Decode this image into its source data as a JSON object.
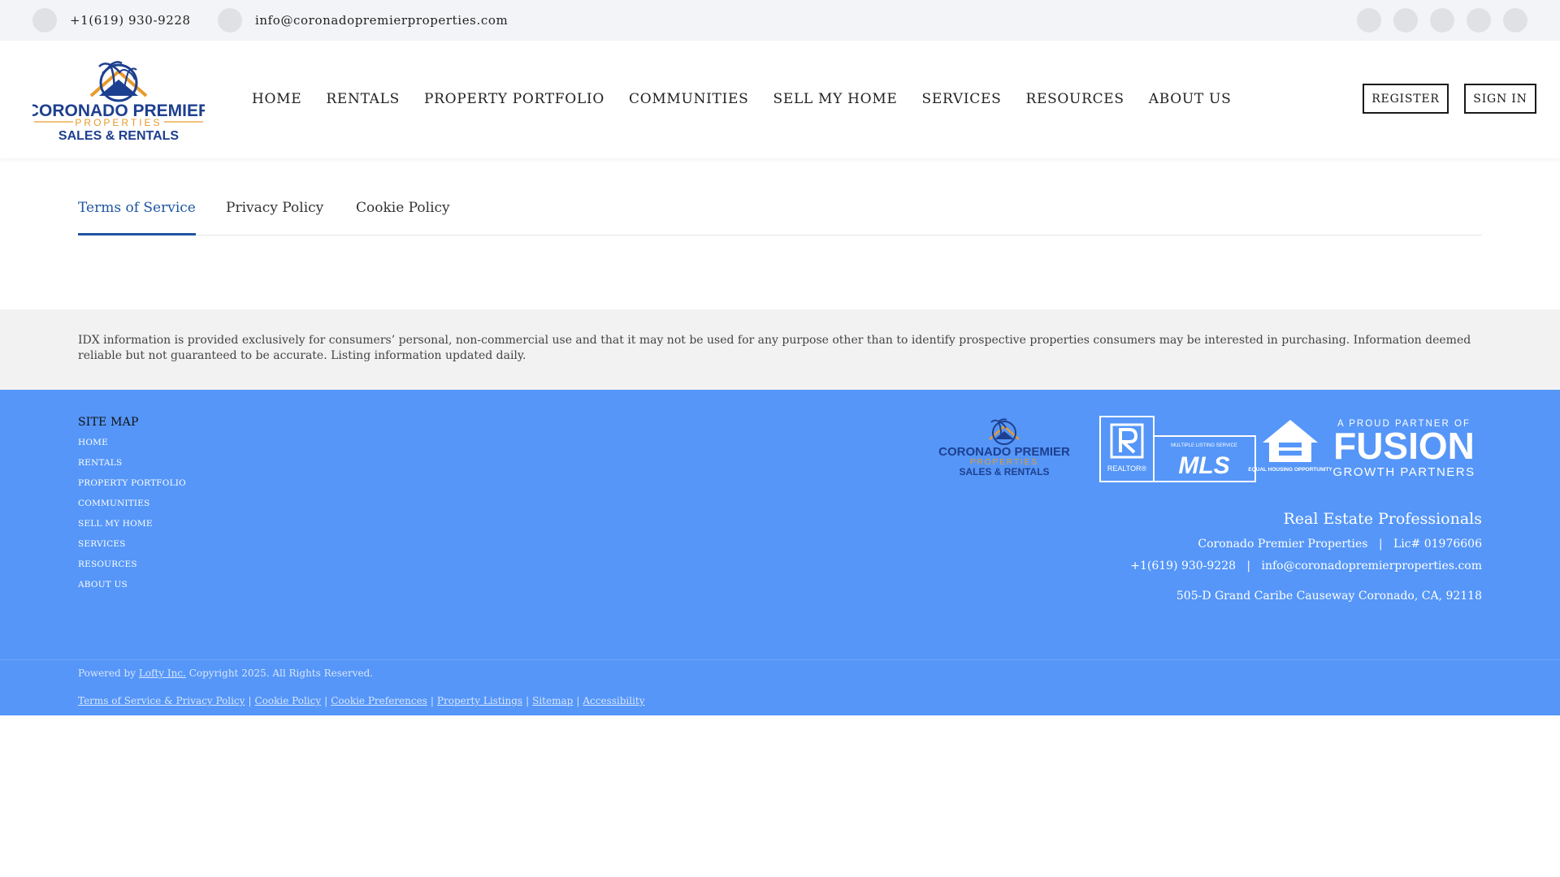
{
  "topbar": {
    "phone": "+1(619) 930-9228",
    "email": "info@coronadopremierproperties.com",
    "phone_icon": "phone-icon",
    "email_icon": "email-icon",
    "social_icons": [
      "facebook-icon",
      "instagram-icon",
      "linkedin-icon",
      "youtube-icon",
      "twitter-icon"
    ]
  },
  "logo": {
    "line1": "CORONADO PREMIER",
    "line2": "PROPERTIES",
    "line3": "SALES & RENTALS"
  },
  "nav": {
    "items": [
      "HOME",
      "RENTALS",
      "PROPERTY PORTFOLIO",
      "COMMUNITIES",
      "SELL MY HOME",
      "SERVICES",
      "RESOURCES",
      "ABOUT US"
    ],
    "register": "REGISTER",
    "sign_in": "SIGN IN"
  },
  "tabs": {
    "items": [
      "Terms of Service",
      "Privacy Policy",
      "Cookie Policy"
    ],
    "active": "Terms of Service"
  },
  "disclaimer": "IDX information is provided exclusively for consumers’ personal, non-commercial use and that it may not be used for any purpose other than to identify prospective properties consumers may be interested in purchasing. Information deemed reliable but not guaranteed to be accurate. Listing information updated daily.",
  "footer": {
    "sitemap_title": "SITE MAP",
    "sitemap": [
      "HOME",
      "RENTALS",
      "PROPERTY PORTFOLIO",
      "COMMUNITIES",
      "SELL MY HOME",
      "SERVICES",
      "RESOURCES",
      "ABOUT US"
    ],
    "badges": {
      "logo_line1": "CORONADO PREMIER",
      "logo_line2": "PROPERTIES",
      "logo_line3": "SALES & RENTALS",
      "realtor": "REALTOR®",
      "mls_small": "MULTIPLE LISTING SERVICE",
      "mls": "MLS",
      "eho": "EQUAL HOUSING OPPORTUNITY",
      "fusion_top": "A PROUD PARTNER OF",
      "fusion": "FUSION",
      "fusion_bottom": "GROWTH PARTNERS"
    },
    "rep_title": "Real Estate Professionals",
    "company": "Coronado Premier Properties",
    "license": "Lic# 01976606",
    "phone": "+1(619) 930-9228",
    "email": "info@coronadopremierproperties.com",
    "address": "505-D Grand Caribe Causeway Coronado, CA, 92118",
    "powered_prefix": "Powered by",
    "powered_link": "Lofty Inc.",
    "copyright": "Copyright 2025. All Rights Reserved.",
    "legal_links": [
      "Terms of Service & Privacy Policy",
      "Cookie Policy",
      "Cookie Preferences",
      "Property Listings",
      "Sitemap",
      "Accessibility"
    ],
    "legal_sep": "|"
  },
  "colors": {
    "accent": "#1e56a0",
    "footer_bg": "#5596f8",
    "logo_orange": "#e89a2c",
    "logo_navy": "#1d3f8f"
  }
}
